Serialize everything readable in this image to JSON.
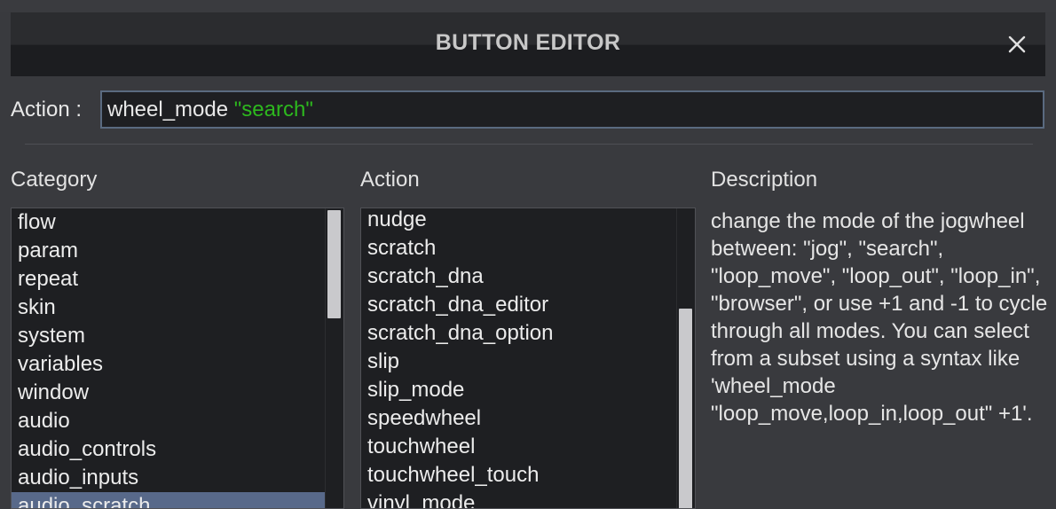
{
  "dialog": {
    "title": "BUTTON EDITOR"
  },
  "action_field": {
    "label": "Action :",
    "command": "wheel_mode",
    "argument": "\"search\""
  },
  "columns": {
    "category_header": "Category",
    "action_header": "Action",
    "description_header": "Description"
  },
  "category_list": {
    "items": [
      "flow",
      "param",
      "repeat",
      "skin",
      "system",
      "variables",
      "window",
      "audio",
      "audio_controls",
      "audio_inputs",
      "audio_scratch"
    ],
    "selected": "audio_scratch"
  },
  "action_list": {
    "items": [
      "nudge",
      "scratch",
      "scratch_dna",
      "scratch_dna_editor",
      "scratch_dna_option",
      "slip",
      "slip_mode",
      "speedwheel",
      "touchwheel",
      "touchwheel_touch",
      "vinyl_mode"
    ]
  },
  "description": {
    "text": "change the mode of the jogwheel between: \"jog\", \"search\", \"loop_move\", \"loop_out\", \"loop_in\", \"browser\", or use +1 and -1 to cycle through all modes. You can select from a subset using a syntax like 'wheel_mode \"loop_move,loop_in,loop_out\" +1'."
  },
  "icons": {
    "close": "close-icon"
  }
}
